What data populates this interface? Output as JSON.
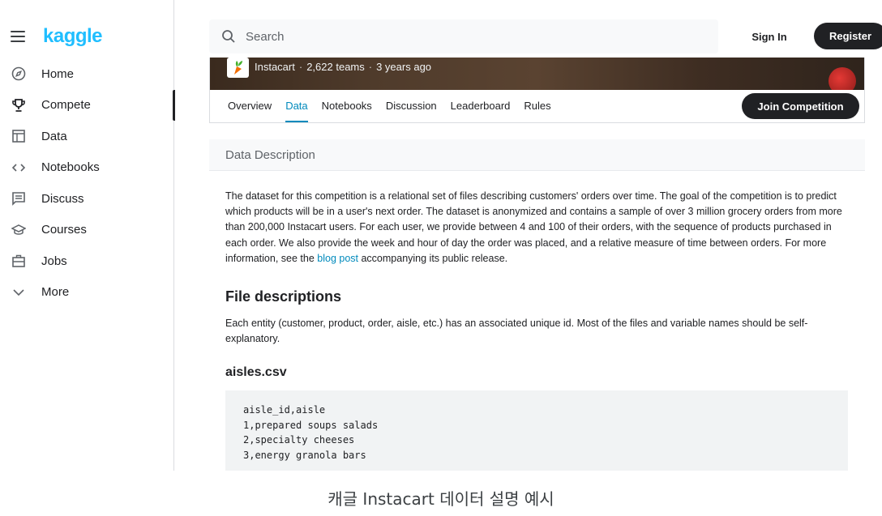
{
  "brand": {
    "logo": "kaggle"
  },
  "sidebar": {
    "items": [
      {
        "label": "Home",
        "icon": "compass-icon"
      },
      {
        "label": "Compete",
        "icon": "trophy-icon",
        "active": true
      },
      {
        "label": "Data",
        "icon": "table-icon"
      },
      {
        "label": "Notebooks",
        "icon": "code-icon"
      },
      {
        "label": "Discuss",
        "icon": "discussion-icon"
      },
      {
        "label": "Courses",
        "icon": "graduation-cap-icon"
      },
      {
        "label": "Jobs",
        "icon": "briefcase-icon"
      },
      {
        "label": "More",
        "icon": "chevron-down-icon"
      }
    ]
  },
  "header": {
    "search_placeholder": "Search",
    "signin_label": "Sign In",
    "register_label": "Register"
  },
  "competition": {
    "host": "Instacart",
    "teams": "2,622 teams",
    "age": "3 years ago",
    "tabs": [
      "Overview",
      "Data",
      "Notebooks",
      "Discussion",
      "Leaderboard",
      "Rules"
    ],
    "active_tab": "Data",
    "join_label": "Join Competition"
  },
  "content": {
    "section_title": "Data Description",
    "description_before_link": "The dataset for this competition is a relational set of files describing customers' orders over time. The goal of the competition is to predict which products will be in a user's next order. The dataset is anonymized and contains a sample of over 3 million grocery orders from more than 200,000 Instacart users. For each user, we provide between 4 and 100 of their orders, with the sequence of products purchased in each order. We also provide the week and hour of day the order was placed, and a relative measure of time between orders. For more information, see the ",
    "link_text": "blog post",
    "description_after_link": " accompanying its public release.",
    "file_desc_title": "File descriptions",
    "file_desc_text": "Each entity (customer, product, order, aisle, etc.) has an associated unique id. Most of the files and variable names should be self-explanatory.",
    "file_name": "aisles.csv",
    "code_lines": [
      "aisle_id,aisle",
      "1,prepared soups salads",
      "2,specialty cheeses",
      "3,energy granola bars"
    ]
  },
  "caption": "캐글 Instacart 데이터 설명 예시",
  "colors": {
    "accent": "#20beff",
    "link": "#008abc",
    "dark": "#202124"
  }
}
